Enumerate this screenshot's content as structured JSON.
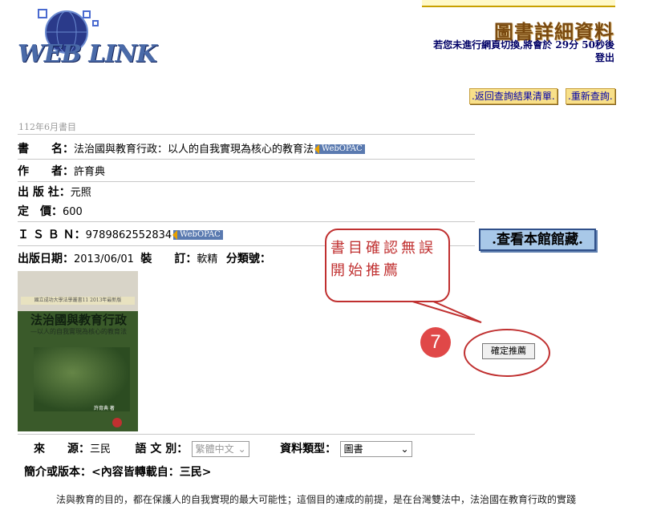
{
  "header": {
    "logo_alt": "WEB LINK",
    "page_title": "圖書詳細資料",
    "timeout_line1": "若您未進行網頁切換,將會於 29分 50秒後",
    "timeout_line2": "登出"
  },
  "nav": {
    "back_label": ".返回查詢結果清單.",
    "new_search_label": ".重新查詢."
  },
  "record": {
    "month_label": "112年6月書目",
    "title_label": "書　　名：",
    "title_value": "法治國與教育行政：以人的自我實現為核心的教育法",
    "author_label": "作　　者：",
    "author_value": "許育典",
    "publisher_label": "出 版 社：",
    "publisher_value": "元照",
    "price_label": "定　價：",
    "price_value": "600",
    "isbn_label": "Ｉ Ｓ Ｂ Ｎ：",
    "isbn_value": "9789862552834",
    "pubdate_label": "出版日期：",
    "pubdate_value": "2013/06/01",
    "binding_label": "裝　　訂：",
    "binding_value": "軟精",
    "class_label": "分類號：",
    "webopac_label": "WebOPAC"
  },
  "cover": {
    "series": "國立成功大學法學叢書11 2013年最新版",
    "title": "法治國與教育行政",
    "subtitle": "—以人的自我實現為核心的教育法",
    "author": "許育典 著"
  },
  "holdings_button": ".查看本館館藏.",
  "annotation": {
    "bubble_text": "書目確認無誤開始推薦",
    "step_number": "7"
  },
  "confirm_button": "確定推薦",
  "meta": {
    "source_label": "來　　源：",
    "source_value": "三民",
    "language_label": "語 文 別：",
    "language_value": "繁體中文",
    "type_label": "資料類型：",
    "type_value": "圖書"
  },
  "intro": {
    "heading": "簡介或版本：<內容皆轉載自：三民>",
    "first_line": "法與教育的目的，都在保護人的自我實現的最大可能性；這個目的達成的前提，是在台灣雙法中，法治國在教育行政的實踐"
  }
}
